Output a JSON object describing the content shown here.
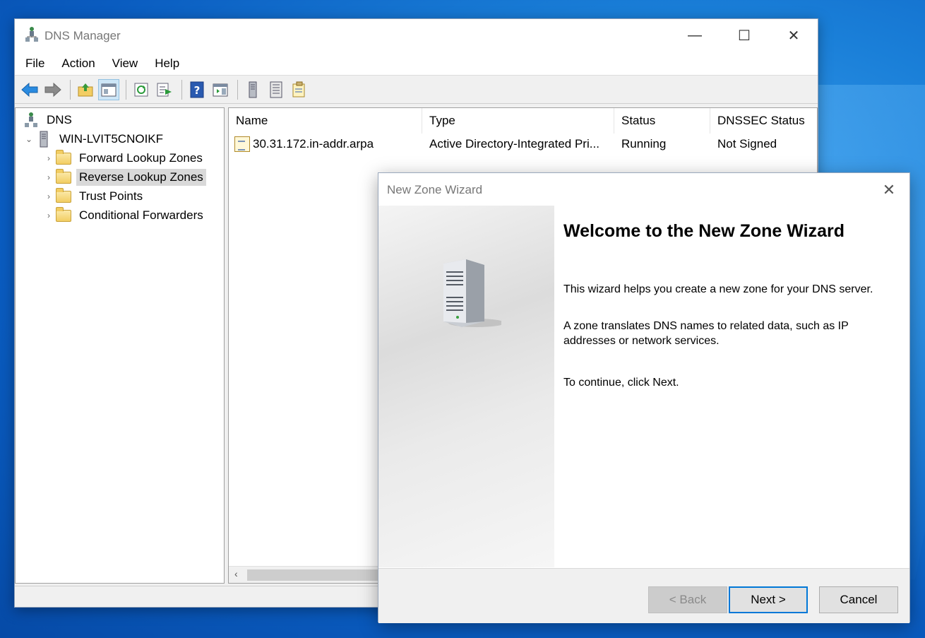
{
  "window": {
    "title": "DNS Manager",
    "minimize_glyph": "—",
    "maximize_glyph": "☐",
    "close_glyph": "✕"
  },
  "menu": [
    "File",
    "Action",
    "View",
    "Help"
  ],
  "toolbar": {
    "buttons": [
      "back-arrow-icon",
      "forward-arrow-icon",
      "up-folder-icon",
      "show-hide-tree-icon",
      "refresh-icon",
      "export-list-icon",
      "help-icon",
      "action-pane-icon",
      "server-icon",
      "list-icon",
      "properties-icon"
    ]
  },
  "tree": {
    "root": "DNS",
    "server": "WIN-LVIT5CNOIKF",
    "children": [
      "Forward Lookup Zones",
      "Reverse Lookup Zones",
      "Trust Points",
      "Conditional Forwarders"
    ],
    "expanded_glyph": "⌄",
    "collapsed_glyph": "›"
  },
  "list": {
    "columns": [
      "Name",
      "Type",
      "Status",
      "DNSSEC Status"
    ],
    "rows": [
      {
        "name": "30.31.172.in-addr.arpa",
        "type": "Active Directory-Integrated Pri...",
        "status": "Running",
        "dnssec": "Not Signed"
      }
    ],
    "scroll_left_glyph": "‹"
  },
  "wizard": {
    "title": "New Zone Wizard",
    "close_glyph": "✕",
    "heading": "Welcome to the New Zone Wizard",
    "paragraphs": [
      "This wizard helps you create a new zone for your DNS server.",
      "A zone translates DNS names to related data, such as IP addresses or network services.",
      "To continue, click Next."
    ],
    "back_label": "< Back",
    "next_label": "Next >",
    "cancel_label": "Cancel"
  }
}
